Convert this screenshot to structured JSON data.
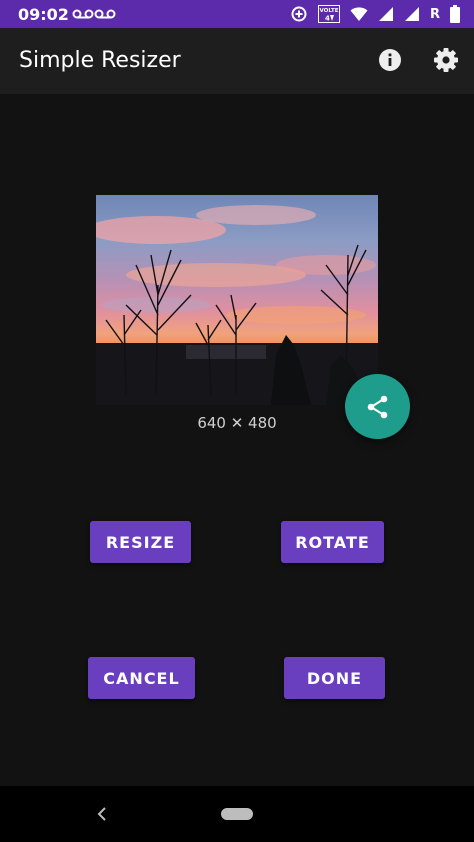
{
  "status_bar": {
    "time": "09:02",
    "voicemail_icons": [
      "voicemail-icon",
      "voicemail-icon"
    ],
    "icons": [
      "data-saver-icon",
      "volte-icon",
      "wifi-icon",
      "signal-icon",
      "signal-icon",
      "battery-icon"
    ],
    "volte_text": "VOLTE",
    "roaming": "R"
  },
  "app_bar": {
    "title": "Simple Resizer",
    "actions": [
      "info-icon",
      "gear-icon"
    ]
  },
  "image": {
    "dimensions": "640 ✕ 480"
  },
  "fab": {
    "icon": "share-icon"
  },
  "buttons": {
    "resize": "RESIZE",
    "rotate": "ROTATE",
    "cancel": "CANCEL",
    "done": "DONE"
  },
  "colors": {
    "status_bar": "#5b2bab",
    "app_bar": "#1e1e1e",
    "background": "#121212",
    "button": "#6a3fbf",
    "fab": "#1e9c8c"
  },
  "nav_bar": {
    "icons": [
      "back-icon",
      "home-pill-icon"
    ]
  }
}
